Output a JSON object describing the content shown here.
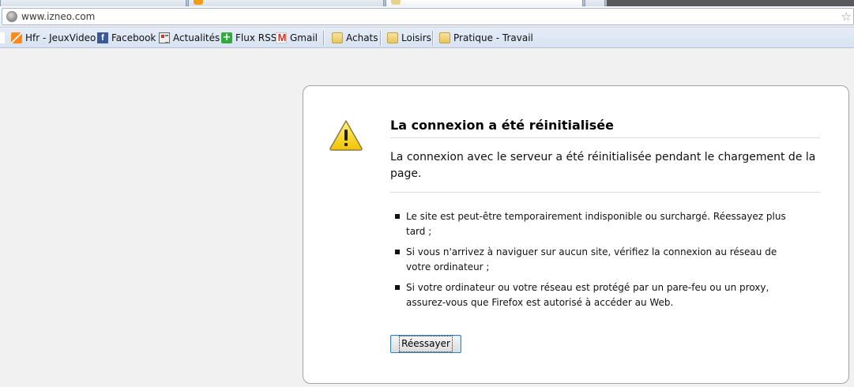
{
  "browser": {
    "url": "www.izneo.com",
    "url_icon": "globe-icon",
    "bookmark_star": "☆"
  },
  "bookmarks": [
    {
      "label": "Hfr - JeuxVideo",
      "icon": "hfr-icon"
    },
    {
      "label": "Facebook",
      "icon": "facebook-icon"
    },
    {
      "label": "Actualités",
      "icon": "news-icon"
    },
    {
      "label": "Flux RSS",
      "icon": "rss-plus-icon"
    },
    {
      "label": "Gmail",
      "icon": "gmail-icon"
    },
    {
      "label": "Achats",
      "icon": "folder-icon"
    },
    {
      "label": "Loisirs",
      "icon": "folder-icon"
    },
    {
      "label": "Pratique - Travail",
      "icon": "folder-icon"
    }
  ],
  "error": {
    "title": "La connexion a été réinitialisée",
    "description": "La connexion avec le serveur a été réinitialisée pendant le chargement de la page.",
    "reasons": [
      "Le site est peut-être temporairement indisponible ou surchargé. Réessayez plus tard ;",
      "Si vous n'arrivez à naviguer sur aucun site, vérifiez la connexion au réseau de votre ordinateur ;",
      "Si votre ordinateur ou votre réseau est protégé par un pare-feu ou un proxy, assurez-vous que Firefox est autorisé à accéder au Web."
    ],
    "retry_label": "Réessayer",
    "icon": "warning-icon"
  },
  "colors": {
    "page_background": "#f1f1f1",
    "facebook": "#3b5998",
    "rss": "#2eab3a",
    "warning": "#f5d10a"
  }
}
